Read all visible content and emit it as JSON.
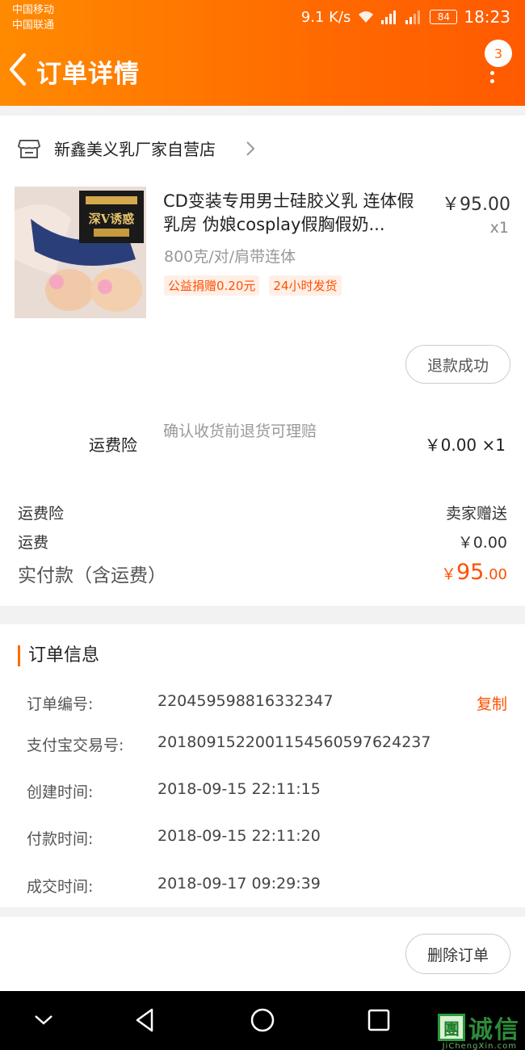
{
  "status_bar": {
    "carrier1": "中国移动",
    "carrier2": "中国联通",
    "speed": "9.1 K/s",
    "battery": "84",
    "time": "18:23"
  },
  "header": {
    "title": "订单详情",
    "badge_count": "3",
    "back_icon": "chevron-left-icon",
    "more_icon": "more-vertical-icon"
  },
  "shop": {
    "name": "新鑫美义乳厂家自营店",
    "icon": "store-icon"
  },
  "product": {
    "name": "CD变装专用男士硅胶义乳 连体假乳房 伪娘cosplay假胸假奶...",
    "price": "￥95.00",
    "qty": "x1",
    "spec": "800克/对/肩带连体",
    "tags": [
      "公益捐赠0.20元",
      "24小时发货"
    ],
    "image_banner": "深V诱惑",
    "refund_button": "退款成功"
  },
  "insurance": {
    "label": "运费险",
    "desc": "确认收货前退货可理赔",
    "price": "￥0.00 ×1"
  },
  "summary": {
    "insurance_label": "运费险",
    "insurance_value": "卖家赠送",
    "shipping_label": "运费",
    "shipping_value": "￥0.00",
    "total_label": "实付款（含运费）",
    "total_currency": "￥",
    "total_int": "95",
    "total_dec": ".00"
  },
  "order_info": {
    "title": "订单信息",
    "rows": [
      {
        "key": "订单编号:",
        "value": "220459598816332347"
      },
      {
        "key": "支付宝交易号:",
        "value": "2018091522001154560597624237"
      },
      {
        "key": "创建时间:",
        "value": "2018-09-15 22:11:15"
      },
      {
        "key": "付款时间:",
        "value": "2018-09-15 22:11:20"
      },
      {
        "key": "成交时间:",
        "value": "2018-09-17 09:29:39"
      }
    ],
    "copy_label": "复制"
  },
  "actions": {
    "delete_button": "删除订单"
  },
  "watermark": {
    "box": "團",
    "text": "诚信",
    "sub": "JiChengXin.com"
  },
  "colors": {
    "accent": "#ff6a00",
    "price_red": "#ff5000"
  }
}
